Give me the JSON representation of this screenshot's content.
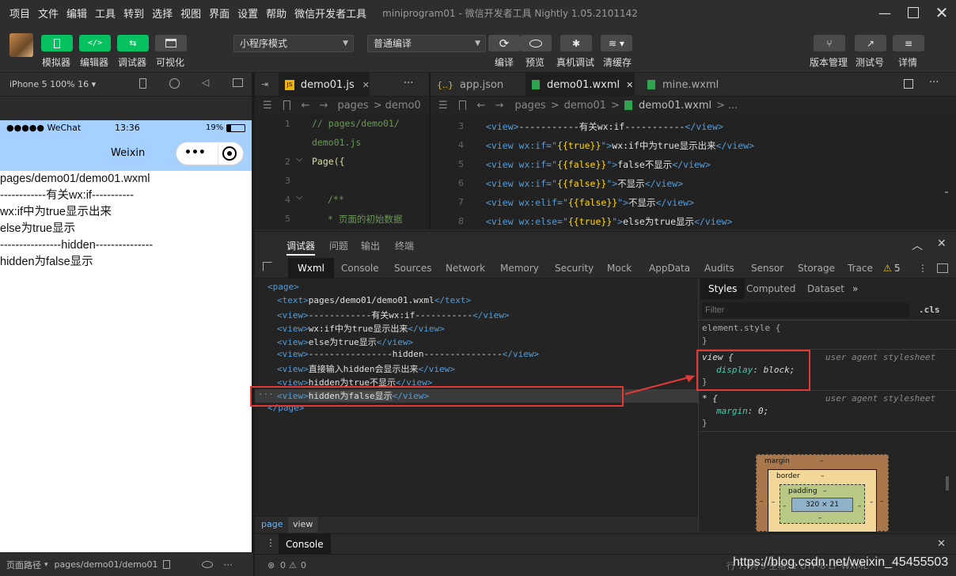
{
  "menu": {
    "items": [
      "项目",
      "文件",
      "编辑",
      "工具",
      "转到",
      "选择",
      "视图",
      "界面",
      "设置",
      "帮助",
      "微信开发者工具"
    ],
    "title": "miniprogram01 - 微信开发者工具 Nightly 1.05.2101142"
  },
  "toolbar": {
    "simulator": "模拟器",
    "editor": "编辑器",
    "debugger": "调试器",
    "visual": "可视化",
    "mode": "小程序模式",
    "compile_mode": "普通编译",
    "compile": "编译",
    "preview": "预览",
    "remote_debug": "真机调试",
    "clear_cache": "清缓存",
    "version": "版本管理",
    "test": "测试号",
    "details": "详情",
    "sim_icon": "phone-icon",
    "editor_icon": "</>",
    "debug_icon": "⇆",
    "visual_icon": "grid-icon"
  },
  "sim": {
    "device": "iPhone 5 100% 16",
    "carrier": "●●●●● WeChat",
    "time": "13:36",
    "battery": "19%",
    "nav_title": "Weixin",
    "footer_path_label": "页面路径",
    "footer_path": "pages/demo01/demo01"
  },
  "phone_lines": [
    "pages/demo01/demo01.wxml",
    "------------有关wx:if-----------",
    "wx:if中为true显示出来",
    "else为true显示",
    "----------------hidden---------------",
    "hidden为false显示"
  ],
  "editor1": {
    "tab": "demo01.js",
    "crumb_pages": "pages",
    "crumb_folder": "demo0",
    "line_numbers": [
      "1",
      "",
      "2",
      "3",
      "4",
      "5"
    ],
    "lines": [
      "// pages/demo01/",
      "demo01.js",
      "Page({",
      "",
      "/**",
      " * 页面的初始数据"
    ]
  },
  "editor2": {
    "tabs": [
      "app.json",
      "demo01.wxml",
      "mine.wxml"
    ],
    "crumb": [
      "pages",
      "demo01",
      "demo01.wxml",
      "..."
    ],
    "line_numbers": [
      "3",
      "4",
      "5",
      "6",
      "7",
      "8"
    ],
    "lines": [
      {
        "pre": "<view>",
        "text": "-----------有关wx:if-----------",
        "post": "</view>"
      },
      {
        "pre": "<view wx:if=\"",
        "bind": "{{true}}",
        "mid": "\">",
        "text": "wx:if中为true显示出来",
        "post": "</view>"
      },
      {
        "pre": "<view wx:if=\"",
        "bind": "{{false}}",
        "mid": "\">",
        "text": "false不显示",
        "post": "</view>"
      },
      {
        "pre": "<view wx:if=\"",
        "bind": "{{false}}",
        "mid": "\">",
        "text": "不显示",
        "post": "</view>"
      },
      {
        "pre": "<view wx:elif=\"",
        "bind": "{{false}}",
        "mid": "\">",
        "text": "不显示",
        "post": "</view>"
      },
      {
        "pre": "<view wx:else=\"",
        "bind": "{{true}}",
        "mid": "\">",
        "text": "else为true显示",
        "post": "</view>"
      }
    ]
  },
  "devtools": {
    "top_tabs": [
      "调试器",
      "问题",
      "输出",
      "终端"
    ],
    "tabs": [
      "Wxml",
      "Console",
      "Sources",
      "Network",
      "Memory",
      "Security",
      "Mock",
      "AppData",
      "Audits",
      "Sensor",
      "Storage",
      "Trace"
    ],
    "warn_count": "5",
    "dom": [
      {
        "open": "<page>",
        "text": "",
        "close": ""
      },
      {
        "open": "<text>",
        "text": "pages/demo01/demo01.wxml",
        "close": "</text>"
      },
      {
        "open": "<view>",
        "text": "------------有关wx:if-----------",
        "close": "</view>"
      },
      {
        "open": "<view>",
        "text": "wx:if中为true显示出来",
        "close": "</view>"
      },
      {
        "open": "<view>",
        "text": "else为true显示",
        "close": "</view>"
      },
      {
        "open": "<view>",
        "text": "----------------hidden---------------",
        "close": "</view>"
      },
      {
        "open": "<view>",
        "text": "直接输入hidden会显示出来",
        "close": "</view>"
      },
      {
        "open": "<view>",
        "text": "hidden为true不显示",
        "close": "</view>"
      },
      {
        "open": "<view>",
        "text": "hidden为false显示",
        "close": "</view>"
      },
      {
        "open": "</page>",
        "text": "",
        "close": ""
      }
    ],
    "dom_breadcrumb": [
      "page",
      "view"
    ],
    "styles_tabs": [
      "Styles",
      "Computed",
      "Dataset"
    ],
    "filter_placeholder": "Filter",
    "cls": ".cls",
    "rule_element": "element.style {",
    "rule_close": "}",
    "rule_view_sel": "view {",
    "rule_view_prop": "display",
    "rule_view_val": "block;",
    "rule_source": "user agent stylesheet",
    "rule_star_sel": "* {",
    "rule_star_prop": "margin",
    "rule_star_val": "0;",
    "box": {
      "margin": "margin",
      "border": "border",
      "padding": "padding",
      "dash": "–",
      "size": "320 × 21"
    },
    "console_tab": "Console",
    "status_errors": "0",
    "status_warnings": "0",
    "status_right": "行 7, 列 9 空格: 2 UTF-8 LF WXML",
    "watermark": "https://blog.csdn.net/weixin_45455503"
  },
  "colors": {
    "accent": "#07c160",
    "phone_nav": "#a6d1ff",
    "highlight": "#e53935"
  }
}
